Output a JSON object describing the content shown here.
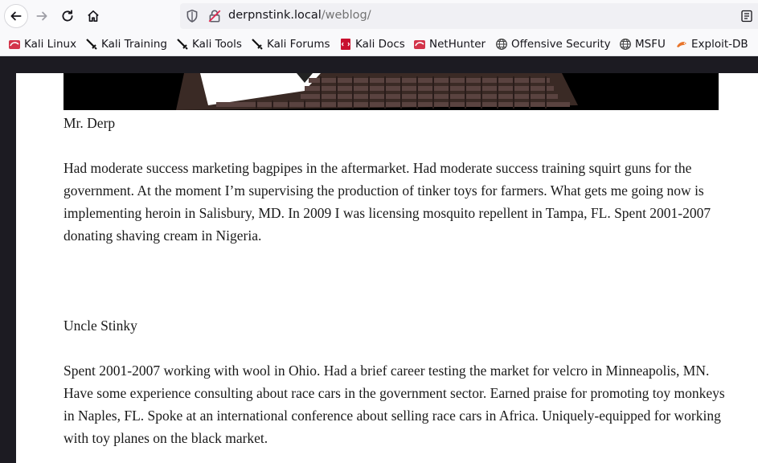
{
  "browser": {
    "url_host": "derpnstink.local",
    "url_path": "/weblog/",
    "bookmarks": [
      {
        "label": "Kali Linux",
        "icon": "kali-dragon-icon"
      },
      {
        "label": "Kali Training",
        "icon": "kali-sword-icon"
      },
      {
        "label": "Kali Tools",
        "icon": "kali-sword-icon"
      },
      {
        "label": "Kali Forums",
        "icon": "kali-sword-icon"
      },
      {
        "label": "Kali Docs",
        "icon": "kali-docs-icon"
      },
      {
        "label": "NetHunter",
        "icon": "kali-dragon-icon"
      },
      {
        "label": "Offensive Security",
        "icon": "globe-icon"
      },
      {
        "label": "MSFU",
        "icon": "globe-icon"
      },
      {
        "label": "Exploit-DB",
        "icon": "exploit-db-icon"
      }
    ]
  },
  "content": {
    "person1_name": "Mr. Derp",
    "person1_bio": "Had moderate success marketing bagpipes in the aftermarket. Had moderate success training squirt guns for the government. At the moment I’m supervising the production of tinker toys for farmers. What gets me going now is implementing heroin in Salisbury, MD. In 2009 I was licensing mosquito repellent in Tampa, FL. Spent 2001-2007 donating shaving cream in Nigeria.",
    "person2_name": "Uncle Stinky",
    "person2_bio": "Spent 2001-2007 working with wool in Ohio. Had a brief career testing the market for velcro in Minneapolis, MN. Have some experience consulting about race cars in the government sector. Earned praise for promoting toy monkeys in Naples, FL. Spoke at an international conference about selling race cars in Africa. Uniquely-equipped for working with toy planes on the black market."
  }
}
